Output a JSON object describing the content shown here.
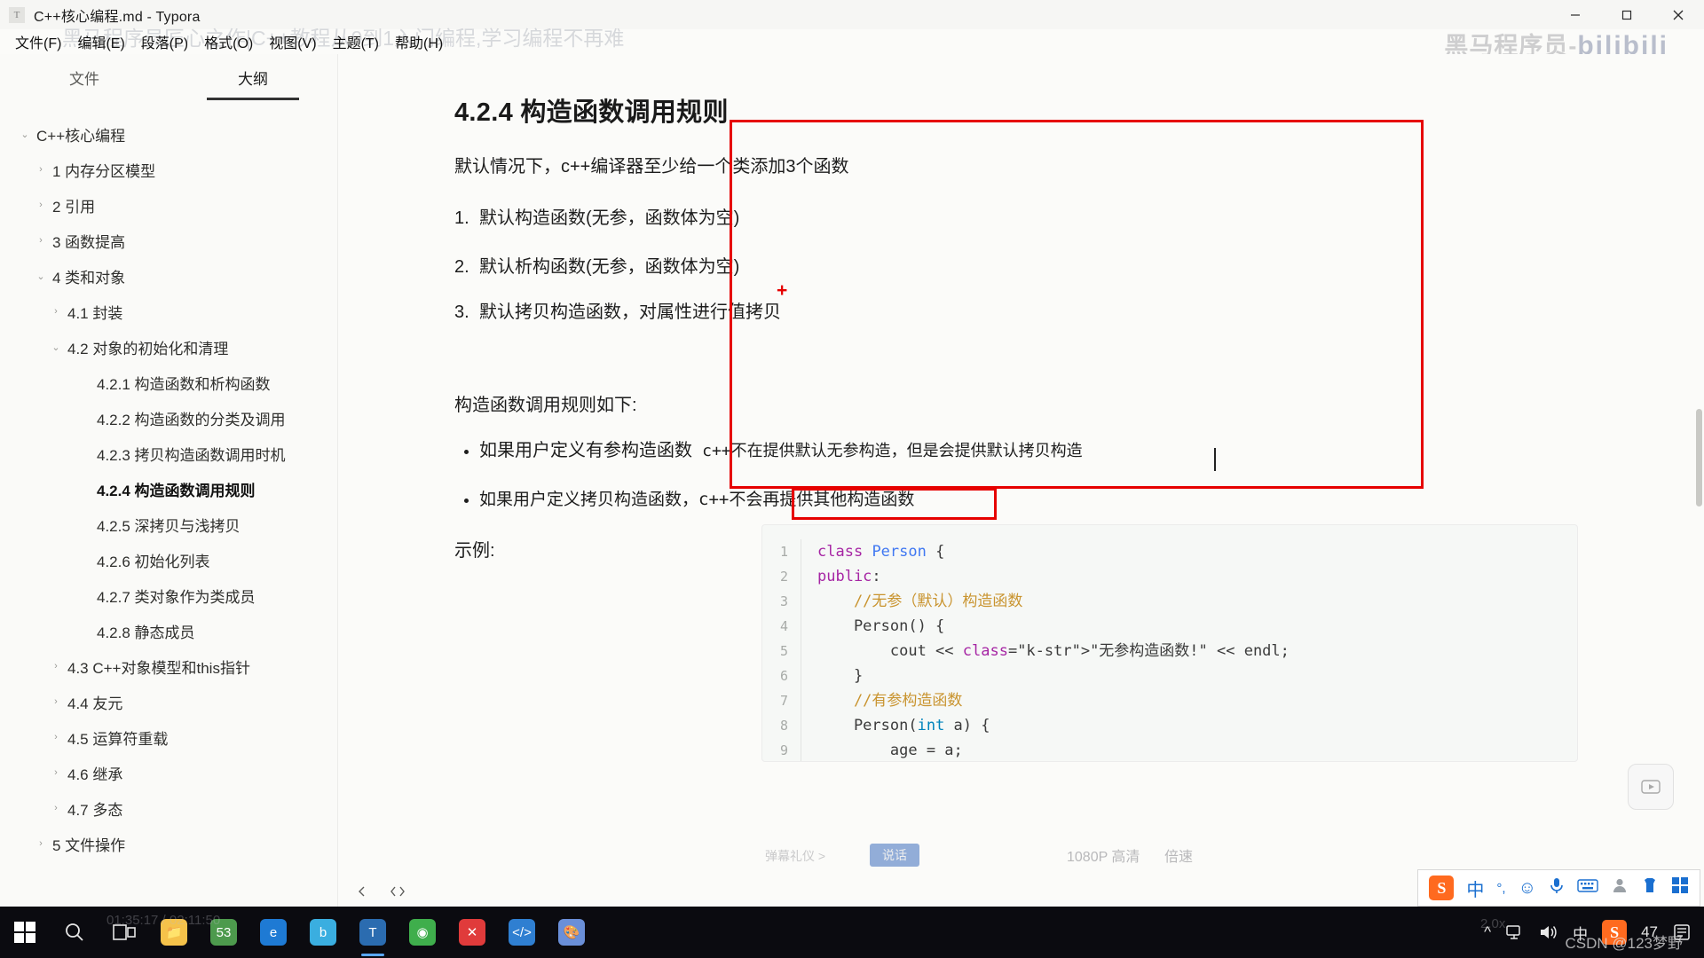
{
  "window": {
    "title": "C++核心编程.md - Typora",
    "app_icon": "T",
    "controls": {
      "minimize": "minimize-icon",
      "maximize": "maximize-icon",
      "close": "close-icon"
    }
  },
  "menubar": {
    "items": [
      {
        "label": "文件(F)",
        "name": "menu-file"
      },
      {
        "label": "编辑(E)",
        "name": "menu-edit"
      },
      {
        "label": "段落(P)",
        "name": "menu-paragraph"
      },
      {
        "label": "格式(O)",
        "name": "menu-format"
      },
      {
        "label": "视图(V)",
        "name": "menu-view"
      },
      {
        "label": "主题(T)",
        "name": "menu-theme"
      },
      {
        "label": "帮助(H)",
        "name": "menu-help"
      }
    ]
  },
  "overlay": {
    "video_title": "黑马程序员匠心之作|C++教程从0到1入门编程,学习编程不再难",
    "brand": "黑马程序员-",
    "brand_sub": "bilibili",
    "timecode": "01:35:17 / 02:11:50",
    "quality": "1080P 高清",
    "speed": "倍速",
    "chapter_hint": "弹幕礼仪 >",
    "chapter_btn": "说话",
    "progress_note": "2.0x"
  },
  "sidebar": {
    "tabs": [
      {
        "label": "文件",
        "name": "tab-files",
        "active": false
      },
      {
        "label": "大纲",
        "name": "tab-outline",
        "active": true
      }
    ],
    "outline": [
      {
        "label": "C++核心编程",
        "level": 0,
        "caret": "down",
        "active": false
      },
      {
        "label": "1 内存分区模型",
        "level": 1,
        "caret": "right",
        "active": false
      },
      {
        "label": "2 引用",
        "level": 1,
        "caret": "right",
        "active": false
      },
      {
        "label": "3 函数提高",
        "level": 1,
        "caret": "right",
        "active": false
      },
      {
        "label": "4 类和对象",
        "level": 1,
        "caret": "down",
        "active": false
      },
      {
        "label": "4.1 封装",
        "level": 2,
        "caret": "right",
        "active": false
      },
      {
        "label": "4.2 对象的初始化和清理",
        "level": 2,
        "caret": "down",
        "active": false
      },
      {
        "label": "4.2.1 构造函数和析构函数",
        "level": 3,
        "caret": "none",
        "active": false
      },
      {
        "label": "4.2.2 构造函数的分类及调用",
        "level": 3,
        "caret": "none",
        "active": false
      },
      {
        "label": "4.2.3 拷贝构造函数调用时机",
        "level": 3,
        "caret": "none",
        "active": false
      },
      {
        "label": "4.2.4 构造函数调用规则",
        "level": 3,
        "caret": "none",
        "active": true
      },
      {
        "label": "4.2.5 深拷贝与浅拷贝",
        "level": 3,
        "caret": "none",
        "active": false
      },
      {
        "label": "4.2.6 初始化列表",
        "level": 3,
        "caret": "none",
        "active": false
      },
      {
        "label": "4.2.7 类对象作为类成员",
        "level": 3,
        "caret": "none",
        "active": false
      },
      {
        "label": "4.2.8 静态成员",
        "level": 3,
        "caret": "none",
        "active": false
      },
      {
        "label": "4.3 C++对象模型和this指针",
        "level": 2,
        "caret": "right",
        "active": false
      },
      {
        "label": "4.4 友元",
        "level": 2,
        "caret": "right",
        "active": false
      },
      {
        "label": "4.5 运算符重载",
        "level": 2,
        "caret": "right",
        "active": false
      },
      {
        "label": "4.6 继承",
        "level": 2,
        "caret": "right",
        "active": false
      },
      {
        "label": "4.7 多态",
        "level": 2,
        "caret": "right",
        "active": false
      },
      {
        "label": "5 文件操作",
        "level": 1,
        "caret": "right",
        "active": false
      }
    ]
  },
  "document": {
    "heading": "4.2.4 构造函数调用规则",
    "intro": "默认情况下，c++编译器至少给一个类添加3个函数",
    "numbered": [
      {
        "num": "1.",
        "text": "默认构造函数(无参，函数体为空)"
      },
      {
        "num": "2.",
        "text": "默认析构函数(无参，函数体为空)"
      },
      {
        "num": "3.",
        "text": "默认拷贝构造函数，对属性进行值拷贝"
      }
    ],
    "rules_lead": "构造函数调用规则如下:",
    "bullets": [
      {
        "highlight": "如果用户定义有参构造函数",
        "rest": "c++不在提供默认无参构造，但是会提供默认拷贝构造"
      },
      {
        "highlight": "",
        "rest": "如果用户定义拷贝构造函数，c++不会再提供其他构造函数"
      }
    ],
    "example_label": "示例:",
    "annotations": {
      "plus_marker": "+"
    }
  },
  "code": {
    "lines": [
      {
        "n": "1",
        "text": "class Person {"
      },
      {
        "n": "2",
        "text": "public:"
      },
      {
        "n": "3",
        "text": "    //无参（默认）构造函数"
      },
      {
        "n": "4",
        "text": "    Person() {"
      },
      {
        "n": "5",
        "text": "        cout << \"无参构造函数!\" << endl;"
      },
      {
        "n": "6",
        "text": "    }"
      },
      {
        "n": "7",
        "text": "    //有参构造函数"
      },
      {
        "n": "8",
        "text": "    Person(int a) {"
      },
      {
        "n": "9",
        "text": "        age = a;"
      }
    ]
  },
  "statusbar": {
    "prev_icon": "chevron-left-icon",
    "source_icon": "source-code-icon"
  },
  "taskbar": {
    "start": "windows-start-icon",
    "search": "search-icon",
    "taskview": "task-view-icon",
    "apps": [
      {
        "name": "file-explorer",
        "glyph": "📁",
        "color": "#f5c24a",
        "active": false
      },
      {
        "name": "calculator-app",
        "glyph": "53",
        "color": "#4d9a4d",
        "active": false
      },
      {
        "name": "browser-app",
        "glyph": "e",
        "color": "#1e7ad4",
        "active": false
      },
      {
        "name": "bilibili-app",
        "glyph": "b",
        "color": "#3aaee0",
        "active": false
      },
      {
        "name": "typora-app",
        "glyph": "T",
        "color": "#2b6cb0",
        "active": true
      },
      {
        "name": "green-app",
        "glyph": "◉",
        "color": "#3fae4c",
        "active": false
      },
      {
        "name": "xmind-app",
        "glyph": "✕",
        "color": "#e03b3b",
        "active": false
      },
      {
        "name": "vscode-app",
        "glyph": "</>",
        "color": "#2f7fd1",
        "active": false
      },
      {
        "name": "paint-app",
        "glyph": "🎨",
        "color": "#6a8fd8",
        "active": false
      }
    ],
    "tray": {
      "chevron": "^",
      "network": "network-icon",
      "volume": "volume-icon",
      "ime": "中",
      "sogou": "S",
      "battery_num": "47",
      "notifications": "notification-icon"
    },
    "watermark": "CSDN @123梦野"
  },
  "ime_toolbar": {
    "logo": "S",
    "mode": "中",
    "punct": "°,",
    "emoji": "☺",
    "mic": "mic-icon",
    "keyboard": "keyboard-icon",
    "user": "user-icon",
    "skin": "skin-icon",
    "apps": "apps-icon"
  },
  "colors": {
    "annotation_red": "#e60000",
    "accent_blue": "#1a6fd0",
    "code_bg": "#f6f8f6",
    "sidebar_bg": "#fafaf8"
  }
}
